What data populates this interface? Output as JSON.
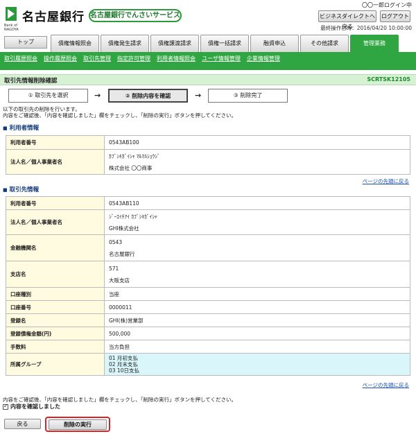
{
  "header": {
    "logo_text": "名古屋銀行",
    "logo_sub": "Bank of\nNAGOYA",
    "service_name": "名古屋銀行でんさいサービス",
    "login_status": "〇〇一郎ログイン中",
    "bizdirect_button": "ビジネスダイレクトへ戻る",
    "logout_button": "ログアウト",
    "last_operation": "最終操作日時：2016/04/20 10:00:00"
  },
  "nav": {
    "top_button": "トップ",
    "tabs": [
      {
        "label": "債権情報照会"
      },
      {
        "label": "債権発生請求"
      },
      {
        "label": "債権譲渡請求"
      },
      {
        "label": "債権一括請求"
      },
      {
        "label": "融資申込"
      },
      {
        "label": "その他請求"
      },
      {
        "label": "管理業務"
      }
    ],
    "active_tab": "管理業務",
    "sub_links": [
      "取引履歴照会",
      "操作履歴照会",
      "取引先管理",
      "指定許可管理",
      "利用者情報照会",
      "ユーザ情報管理",
      "企業情報管理"
    ]
  },
  "page": {
    "title": "取引先情報削除確認",
    "screen_id": "SCRTSK12105",
    "steps": [
      "① 取引先を選択",
      "② 削除内容を確認",
      "③ 削除完了"
    ],
    "instruction_line1": "以下の取引先の削除を行います。",
    "instruction_line2": "内容をご確認後、「内容を確認しました」欄をチェックし、「削除の実行」ボタンを押してください。"
  },
  "user_section": {
    "heading": "利用者情報",
    "rows": {
      "user_no_label": "利用者番号",
      "user_no": "0543AB100",
      "name_label": "法人名／個人事業者名",
      "name_kana": "ｶﾌﾞｼｷｶﾞｲｼｬ ﾏﾙﾏﾙｼｮｳｼﾞ",
      "name": "株式会社 〇〇商事"
    }
  },
  "partner_section": {
    "heading": "取引先情報",
    "rows": {
      "user_no_label": "利用者番号",
      "user_no": "0543AB110",
      "name_label": "法人名／個人事業者名",
      "name_kana": "ｼﾞｰｴｲﾁｱｲ ｶﾌﾞｼｷｶﾞｲｼｬ",
      "name": "GHI株式会社",
      "bank_label": "金融機関名",
      "bank_code": "0543",
      "bank_name": "名古屋銀行",
      "branch_label": "支店名",
      "branch_code": "571",
      "branch_name": "大阪支店",
      "acct_type_label": "口座種別",
      "acct_type": "当座",
      "acct_no_label": "口座番号",
      "acct_no": "0000011",
      "reg_name_label": "登録名",
      "reg_name": "GHI(株)営業部",
      "amount_label": "登録債権金額(円)",
      "amount": "500,000",
      "fee_label": "手数料",
      "fee": "当方負担",
      "group_label": "所属グループ",
      "group_1": "01 月初支払",
      "group_2": "02 月末支払",
      "group_3": "03 10日支払"
    }
  },
  "page_top_link": "ページの先頭に戻る",
  "footer": {
    "instruction": "内容をご確認後、「内容を確認しました」欄をチェックし、「削除の実行」ボタンを押してください。",
    "confirm_label": "内容を確認しました",
    "back_button": "戻る",
    "execute_button": "削除の実行"
  },
  "colors": {
    "accent_green": "#2fa641",
    "highlight_red": "#e02020"
  }
}
